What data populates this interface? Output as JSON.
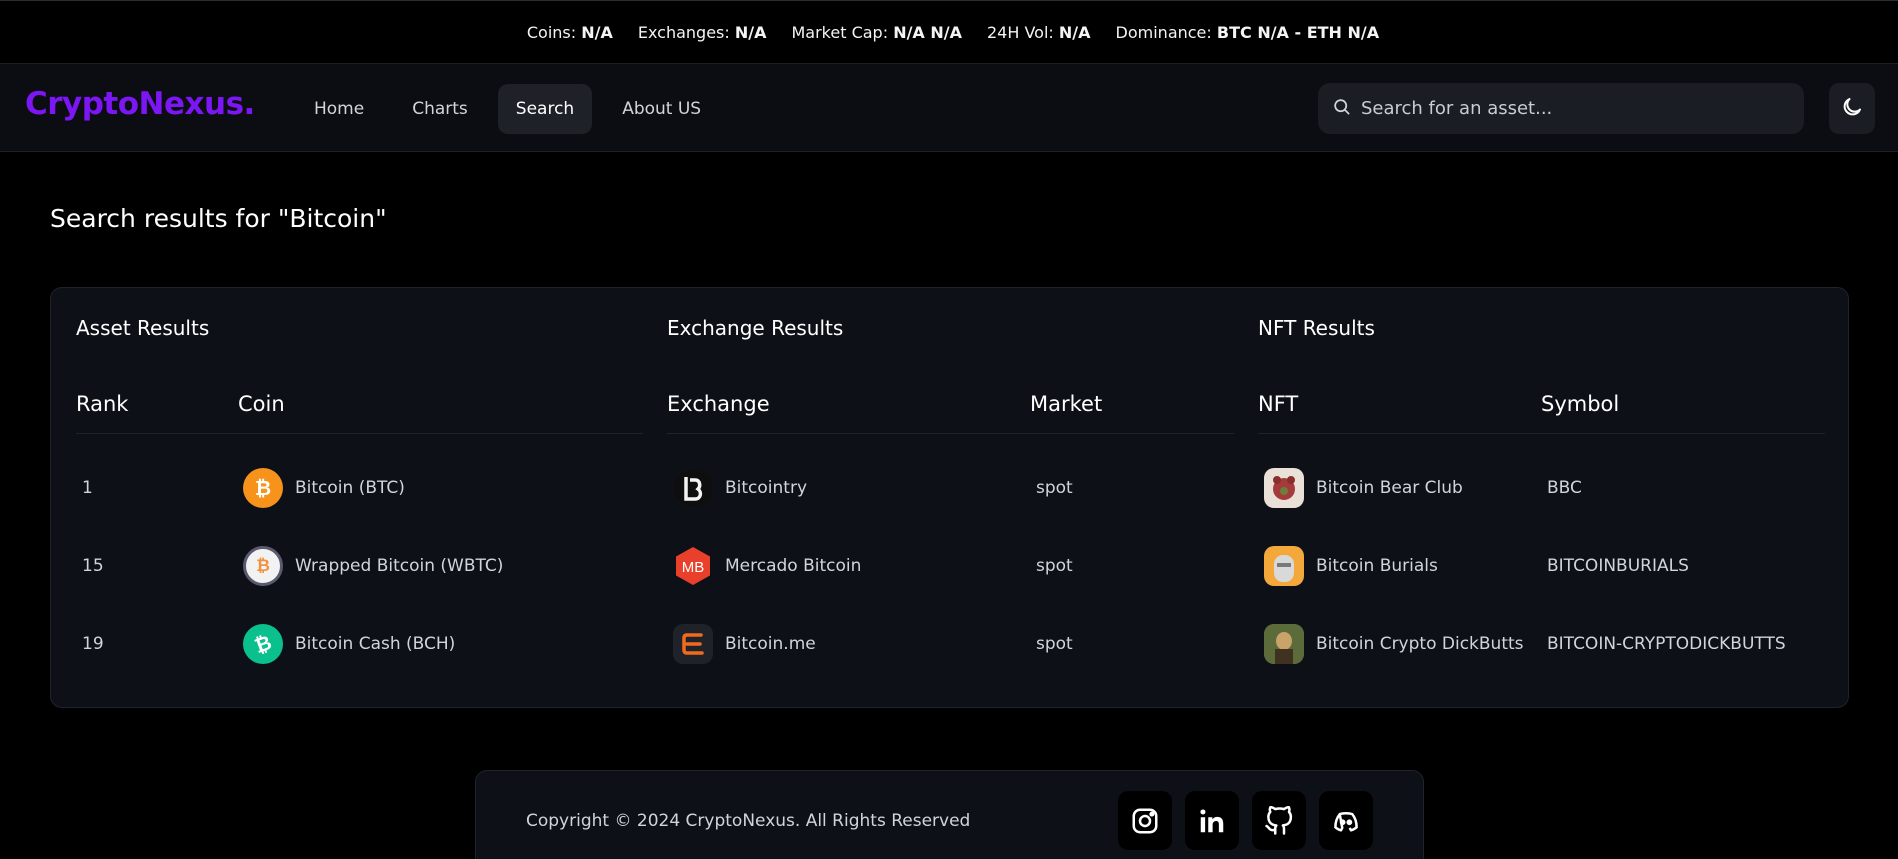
{
  "stats": {
    "coins_label": "Coins:",
    "coins_value": "N/A",
    "exchanges_label": "Exchanges:",
    "exchanges_value": "N/A",
    "marketcap_label": "Market Cap:",
    "marketcap_value": "N/A N/A",
    "vol_label": "24H Vol:",
    "vol_value": "N/A",
    "dominance_label": "Dominance:",
    "dominance_value": "BTC N/A - ETH N/A"
  },
  "nav": {
    "logo": "CryptoNexus.",
    "links": [
      "Home",
      "Charts",
      "Search",
      "About US"
    ],
    "active": "Search",
    "search_placeholder": "Search for an asset..."
  },
  "page": {
    "title": "Search results for \"Bitcoin\""
  },
  "assets": {
    "title": "Asset Results",
    "headers": [
      "Rank",
      "Coin"
    ],
    "rows": [
      {
        "rank": "1",
        "name": "Bitcoin (BTC)",
        "icon": "bitcoin-icon",
        "color": "#f7931a"
      },
      {
        "rank": "15",
        "name": "Wrapped Bitcoin (WBTC)",
        "icon": "wrapped-bitcoin-icon",
        "color": "#e5e5e5"
      },
      {
        "rank": "19",
        "name": "Bitcoin Cash (BCH)",
        "icon": "bitcoin-cash-icon",
        "color": "#0ac18e"
      }
    ]
  },
  "exchanges": {
    "title": "Exchange Results",
    "headers": [
      "Exchange",
      "Market"
    ],
    "rows": [
      {
        "name": "Bitcointry",
        "market": "spot",
        "icon": "bitcointry-logo-icon"
      },
      {
        "name": "Mercado Bitcoin",
        "market": "spot",
        "icon": "mercado-bitcoin-logo-icon",
        "badge": "MB"
      },
      {
        "name": "Bitcoin.me",
        "market": "spot",
        "icon": "bitcoin-me-logo-icon"
      }
    ]
  },
  "nfts": {
    "title": "NFT Results",
    "headers": [
      "NFT",
      "Symbol"
    ],
    "rows": [
      {
        "name": "Bitcoin Bear Club",
        "symbol": "BBC",
        "icon": "bitcoin-bear-club-thumbnail"
      },
      {
        "name": "Bitcoin Burials",
        "symbol": "BITCOINBURIALS",
        "icon": "bitcoin-burials-thumbnail"
      },
      {
        "name": "Bitcoin Crypto DickButts",
        "symbol": "BITCOIN-CRYPTODICKBUTTS",
        "icon": "bitcoin-crypto-dickbutts-thumbnail"
      }
    ]
  },
  "footer": {
    "copyright": "Copyright © 2024 CryptoNexus. All Rights Reserved",
    "socials": [
      "instagram-icon",
      "linkedin-icon",
      "github-icon",
      "discord-icon"
    ]
  },
  "colors": {
    "brand": "#7c16f5",
    "background": "#000000",
    "card": "#0d1016"
  }
}
